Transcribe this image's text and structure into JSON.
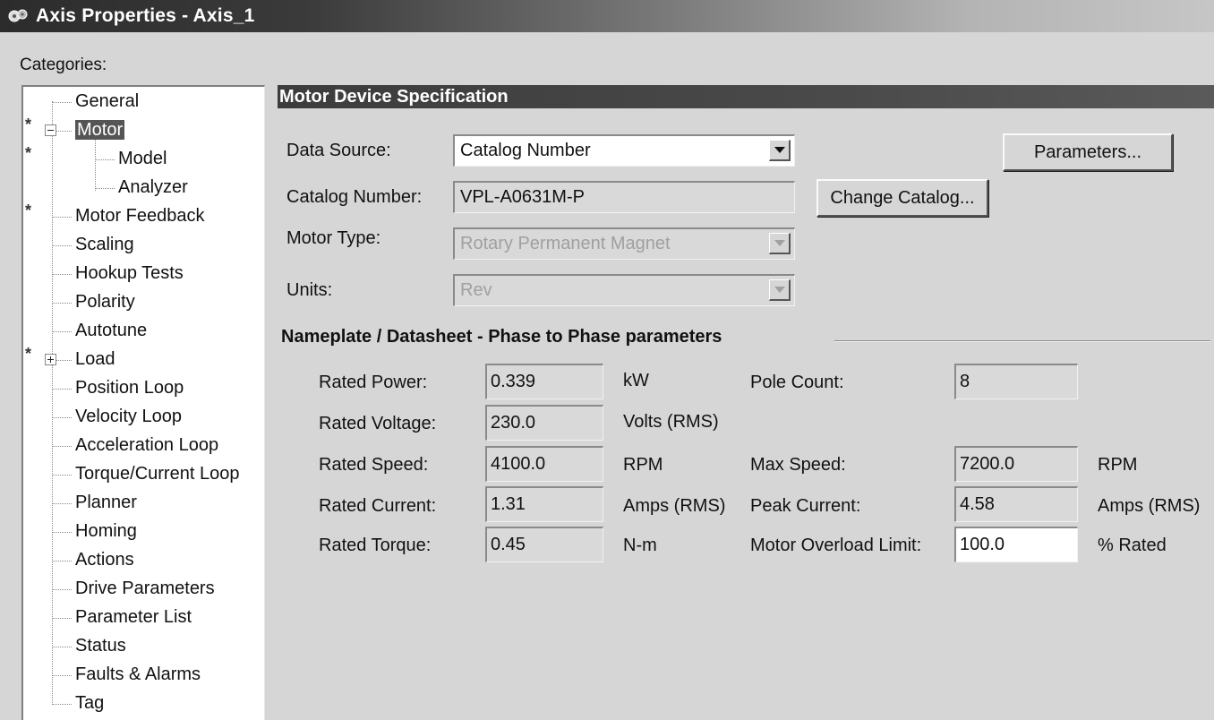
{
  "window": {
    "title": "Axis Properties - Axis_1"
  },
  "sidebar": {
    "label": "Categories:",
    "items": [
      {
        "label": "General",
        "star": false
      },
      {
        "label": "Motor",
        "star": true,
        "expander": "⊟",
        "selected": true
      },
      {
        "label": "Model",
        "star": true,
        "child": true
      },
      {
        "label": "Analyzer",
        "star": false,
        "child": true
      },
      {
        "label": "Motor Feedback",
        "star": true
      },
      {
        "label": "Scaling",
        "star": false
      },
      {
        "label": "Hookup Tests",
        "star": false
      },
      {
        "label": "Polarity",
        "star": false
      },
      {
        "label": "Autotune",
        "star": false
      },
      {
        "label": "Load",
        "star": true,
        "expander": "⊞"
      },
      {
        "label": "Position Loop",
        "star": false
      },
      {
        "label": "Velocity Loop",
        "star": false
      },
      {
        "label": "Acceleration Loop",
        "star": false
      },
      {
        "label": "Torque/Current Loop",
        "star": false
      },
      {
        "label": "Planner",
        "star": false
      },
      {
        "label": "Homing",
        "star": false
      },
      {
        "label": "Actions",
        "star": false
      },
      {
        "label": "Drive Parameters",
        "star": false
      },
      {
        "label": "Parameter List",
        "star": false
      },
      {
        "label": "Status",
        "star": false
      },
      {
        "label": "Faults & Alarms",
        "star": false
      },
      {
        "label": "Tag",
        "star": false
      }
    ],
    "star_symbol": "*"
  },
  "panel": {
    "header": "Motor Device Specification",
    "data_source": {
      "label": "Data Source:",
      "value": "Catalog Number"
    },
    "catalog_number": {
      "label": "Catalog Number:",
      "value": "VPL-A0631M-P"
    },
    "motor_type": {
      "label": "Motor Type:",
      "value": "Rotary Permanent Magnet"
    },
    "units": {
      "label": "Units:",
      "value": "Rev"
    },
    "parameters_button": "Parameters...",
    "change_catalog_button": "Change Catalog...",
    "nameplate": {
      "title": "Nameplate / Datasheet - Phase to Phase parameters",
      "rated_power": {
        "label": "Rated Power:",
        "value": "0.339",
        "unit": "kW"
      },
      "rated_voltage": {
        "label": "Rated Voltage:",
        "value": "230.0",
        "unit": "Volts (RMS)"
      },
      "rated_speed": {
        "label": "Rated Speed:",
        "value": "4100.0",
        "unit": "RPM"
      },
      "rated_current": {
        "label": "Rated Current:",
        "value": "1.31",
        "unit": "Amps (RMS)"
      },
      "rated_torque": {
        "label": "Rated Torque:",
        "value": "0.45",
        "unit": "N-m"
      },
      "pole_count": {
        "label": "Pole Count:",
        "value": "8"
      },
      "max_speed": {
        "label": "Max Speed:",
        "value": "7200.0",
        "unit": "RPM"
      },
      "peak_current": {
        "label": "Peak Current:",
        "value": "4.58",
        "unit": "Amps (RMS)"
      },
      "overload_limit": {
        "label": "Motor Overload Limit:",
        "value": "100.0",
        "unit": "% Rated"
      }
    }
  }
}
